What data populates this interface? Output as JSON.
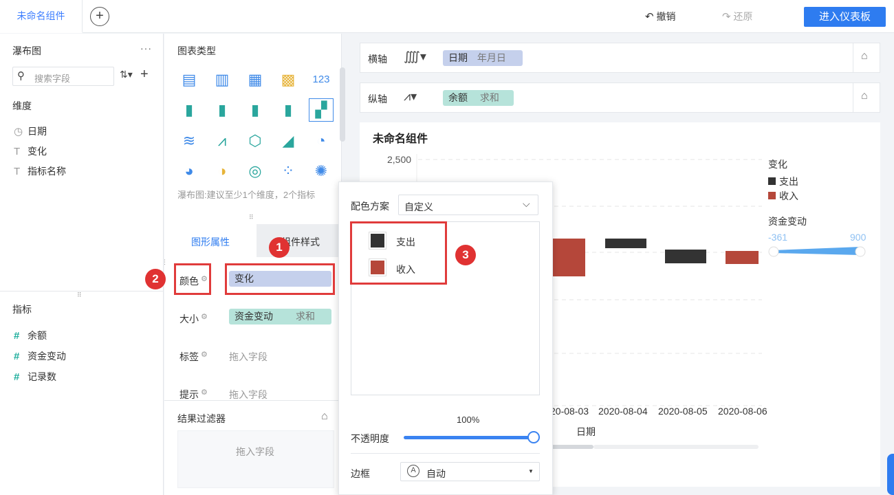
{
  "topbar": {
    "tab_label": "未命名组件",
    "add_label": "+",
    "undo_label": "撤销",
    "redo_label": "还原",
    "enter_dashboard_label": "进入仪表板"
  },
  "left_panel": {
    "title": "瀑布图",
    "more_label": "···",
    "search_placeholder": "搜索字段",
    "dimension_header": "维度",
    "dimensions": [
      {
        "icon": "clock-icon",
        "glyph": "◷",
        "label": "日期"
      },
      {
        "icon": "text-icon",
        "glyph": "T",
        "label": "变化"
      },
      {
        "icon": "text-calc-icon",
        "glyph": "T",
        "label": "指标名称"
      }
    ],
    "measure_header": "指标",
    "measures": [
      {
        "icon": "hash-icon",
        "glyph": "#",
        "label": "余额"
      },
      {
        "icon": "hash-icon",
        "glyph": "#",
        "label": "资金变动"
      },
      {
        "icon": "hash-calc-icon",
        "glyph": "#",
        "label": "记录数"
      }
    ]
  },
  "mid_panel": {
    "chart_type_header": "图表类型",
    "chart_hint": "瀑布图:建议至少1个维度，2个指标",
    "tabs": {
      "graph_props": "图形属性",
      "component_style": "组件样式"
    },
    "rows": {
      "color_label": "颜色",
      "color_value": "变化",
      "size_label": "大小",
      "size_value": "资金变动",
      "size_agg": "求和",
      "label_label": "标签",
      "label_placeholder": "拖入字段",
      "tooltip_label": "提示",
      "tooltip_placeholder": "拖入字段"
    },
    "filter_header": "结果过滤器",
    "filter_placeholder": "拖入字段"
  },
  "axes": {
    "x_label": "横轴",
    "x_field": "日期",
    "x_sub": "年月日",
    "y_label": "纵轴",
    "y_field": "余额",
    "y_sub": "求和"
  },
  "chart_card": {
    "title": "未命名组件",
    "y_tick_top": "2,500",
    "legend_title": "变化",
    "legend_items": [
      {
        "label": "支出",
        "color": "#333333"
      },
      {
        "label": "收入",
        "color": "#b5473a"
      }
    ],
    "size_legend_title": "资金变动",
    "size_min": "-361",
    "size_max": "900",
    "x_axis_title": "日期"
  },
  "chart_data": {
    "type": "bar",
    "categories": [
      "2020-08-03",
      "2020-08-04",
      "2020-08-05",
      "2020-08-06"
    ],
    "x_tick_first_visible": "20-08-03",
    "series": [
      {
        "name": "收入",
        "color": "#b5473a"
      },
      {
        "name": "支出",
        "color": "#333333"
      }
    ],
    "ytick_top": 2500
  },
  "popup": {
    "scheme_label": "配色方案",
    "scheme_value": "自定义",
    "items": [
      {
        "label": "支出",
        "color": "#333333"
      },
      {
        "label": "收入",
        "color": "#b5473a"
      }
    ],
    "opacity_value": "100%",
    "opacity_label": "不透明度",
    "opacity_fraction": 1.0,
    "border_label": "边框",
    "border_value": "自动"
  },
  "markers": [
    "1",
    "2",
    "3"
  ]
}
